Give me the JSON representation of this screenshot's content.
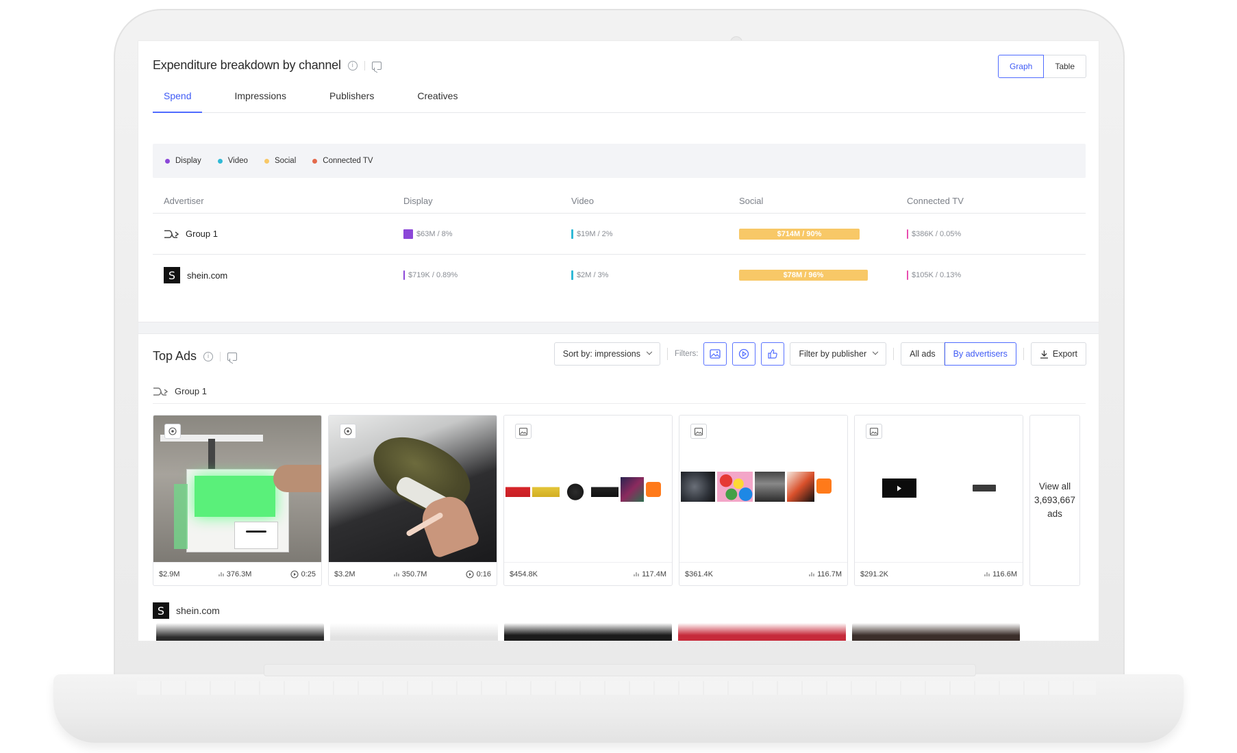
{
  "expenditure": {
    "title": "Expenditure breakdown by channel",
    "view_toggle": {
      "graph": "Graph",
      "table": "Table"
    },
    "tabs": [
      "Spend",
      "Impressions",
      "Publishers",
      "Creatives"
    ],
    "legend": [
      {
        "label": "Display",
        "color": "#8b47d8"
      },
      {
        "label": "Video",
        "color": "#30b9d6"
      },
      {
        "label": "Social",
        "color": "#f8c867"
      },
      {
        "label": "Connected TV",
        "color": "#e46a4c"
      }
    ],
    "table": {
      "headers": [
        "Advertiser",
        "Display",
        "Video",
        "Social",
        "Connected TV"
      ],
      "rows": [
        {
          "advertiser": "Group 1",
          "display": "$63M / 8%",
          "video": "$19M / 2%",
          "social": "$714M / 90%",
          "social_share": 0.9,
          "ctv": "$386K / 0.05%"
        },
        {
          "advertiser": "shein.com",
          "display": "$719K / 0.89%",
          "video": "$2M / 3%",
          "social": "$78M / 96%",
          "social_share": 0.96,
          "ctv": "$105K / 0.13%"
        }
      ]
    }
  },
  "top_ads": {
    "title": "Top Ads",
    "sort_label": "Sort by: impressions",
    "filters_label": "Filters:",
    "publisher_filter": "Filter by publisher",
    "all_ads": "All ads",
    "by_advertisers": "By advertisers",
    "export": "Export",
    "group_name": "Group 1",
    "cards": [
      {
        "type": "video",
        "spend": "$2.9M",
        "impressions": "376.3M",
        "duration": "0:25"
      },
      {
        "type": "video",
        "spend": "$3.2M",
        "impressions": "350.7M",
        "duration": "0:16"
      },
      {
        "type": "image",
        "spend": "$454.8K",
        "impressions": "117.4M",
        "duration": ""
      },
      {
        "type": "image",
        "spend": "$361.4K",
        "impressions": "116.7M",
        "duration": ""
      },
      {
        "type": "image",
        "spend": "$291.2K",
        "impressions": "116.6M",
        "duration": ""
      }
    ],
    "view_all": "View all 3,693,667 ads",
    "second_advertiser": "shein.com"
  }
}
